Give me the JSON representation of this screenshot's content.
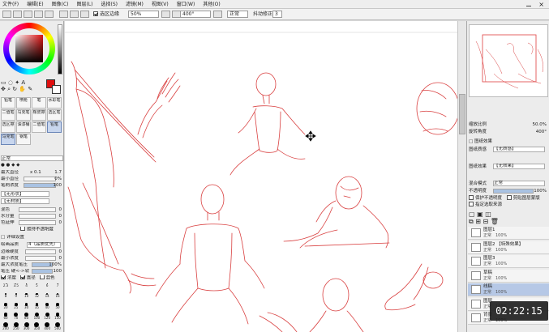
{
  "menu": [
    "文件(F)",
    "编辑(E)",
    "图像(C)",
    "图层(L)",
    "选择(S)",
    "滤镜(M)",
    "视图(V)",
    "窗口(W)",
    "其他(O)"
  ],
  "toolbar": {
    "antialias_label": "选区边缘",
    "zoom": "50%",
    "rotation": "400°",
    "blend_mode": "正常",
    "stabilizer_label": "抖动修正",
    "stabilizer_value": "3"
  },
  "left": {
    "tool_labels": [
      "铅笔",
      "喷枪",
      "笔",
      "水彩笔"
    ],
    "tool_labels2": [
      "二值笔",
      "马克笔",
      "橡皮擦",
      "选区笔"
    ],
    "tool_labels3": [
      "选区擦",
      "油漆桶",
      "二值笔",
      "铅笔"
    ],
    "tool_labels4": [
      "马克笔",
      "钢笔"
    ],
    "mode": "正常",
    "max_size_label": "最大直径",
    "max_size_mult": "x 0.1",
    "max_size_value": "1.7",
    "min_size_label": "最小直径",
    "min_size_value": "0%",
    "density_label": "笔刷浓度",
    "density_value": "100",
    "shape_label": "【无形状】",
    "texture_label": "【无材质】",
    "blend_label": "混色",
    "blend_value": "0",
    "water_label": "水分量",
    "water_value": "0",
    "persist_label": "色延伸",
    "persist_value": "0",
    "keep_opacity_label": "维持不透明度",
    "detail_label": "详细设置",
    "quality_label": "绘画品质",
    "quality_value": "4（品质优先）",
    "edge_label": "边缘硬度",
    "edge_value": "0",
    "min_density_label": "最小浓度",
    "min_density_value": "0",
    "max_press_label": "最大浓度笔压",
    "max_press_value": "100%",
    "press_label": "笔压 硬<->软",
    "press_value": "100",
    "press_opts": [
      "浓度",
      "直径",
      "混色"
    ],
    "brush_sizes": [
      "2.3",
      "3.5",
      "4",
      "5",
      "6",
      "7",
      "8",
      "9",
      "10",
      "12",
      "14",
      "16",
      "20",
      "25",
      "30",
      "35",
      "40",
      "50",
      "60",
      "70",
      "80",
      "100",
      "120",
      "150",
      "200",
      "250",
      "300",
      "350",
      "400",
      "500"
    ]
  },
  "right": {
    "zoom_label": "缩放比例",
    "zoom_value": "50.0%",
    "angle_label": "旋转角度",
    "angle_value": "400°",
    "paper_label": "图纸效果",
    "paper_texture_label": "图纸质感",
    "paper_texture_value": "【无质感】",
    "effect_label": "图纸效果",
    "effect_value": "【无效果】",
    "blend_mode_label": "混合模式",
    "blend_mode_value": "正常",
    "opacity_label": "不透明度",
    "opacity_value": "100%",
    "protect_label": "保护不透明度",
    "clip_label": "剪贴图层蒙版",
    "select_src_label": "指定选取来源",
    "layers": [
      {
        "name": "图层1",
        "mode": "正常",
        "opacity": "100%"
      },
      {
        "name": "图层2 【特殊效果】",
        "mode": "正常",
        "opacity": "100%"
      },
      {
        "name": "图层3",
        "mode": "正常",
        "opacity": "100%"
      },
      {
        "name": "草稿",
        "mode": "正常",
        "opacity": "100%"
      },
      {
        "name": "线稿",
        "mode": "正常",
        "opacity": "100%"
      },
      {
        "name": "图层",
        "mode": "正常",
        "opacity": "100%"
      },
      {
        "name": "背景",
        "mode": "正常",
        "opacity": "100%"
      }
    ]
  },
  "timer": "02:22:15",
  "colors": {
    "primary": "#e01010",
    "secondary": "#ffffff",
    "sketch": "#d94040"
  }
}
